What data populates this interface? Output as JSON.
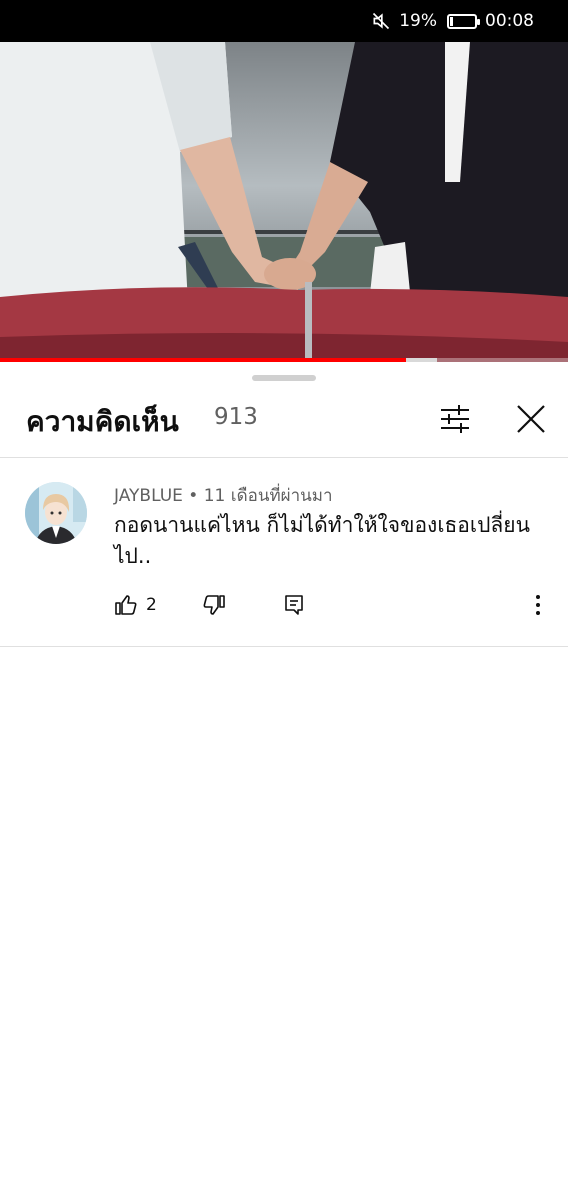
{
  "status_bar": {
    "battery_percent_label": "19%",
    "battery_level": 0.19,
    "time": "00:08",
    "mute_icon": "mute-icon"
  },
  "video": {
    "progress_fraction": 0.715,
    "buffered_until_fraction": 0.77,
    "colors": {
      "progress": "#ff0000",
      "buffer": "#d9d9d9"
    }
  },
  "comments_panel": {
    "title": "ความคิดเห็น",
    "count": "913",
    "sort_icon": "tune-icon",
    "close_icon": "close-icon"
  },
  "comments": [
    {
      "author": "JAYBLUE",
      "separator": "•",
      "time_ago": "11 เดือนที่ผ่านมา",
      "text": "กอดนานแค่ไหน ก็ไม่ได้ทำให้ใจของเธอเปลี่ยนไป..",
      "likes": "2",
      "icons": [
        "thumb-up-icon",
        "thumb-down-icon",
        "reply-icon",
        "more-vert-icon"
      ]
    }
  ]
}
